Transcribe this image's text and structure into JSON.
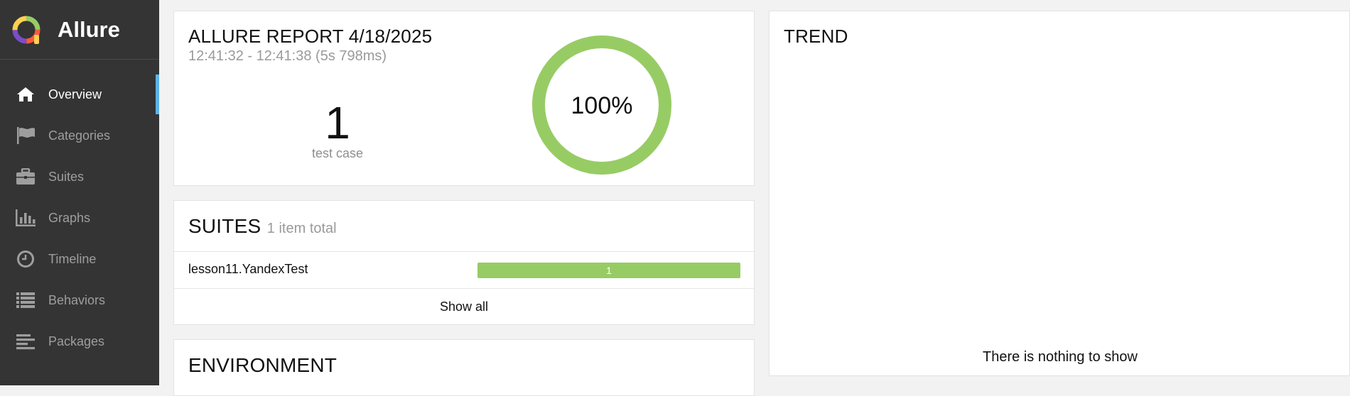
{
  "brand": {
    "name": "Allure"
  },
  "sidebar": {
    "items": [
      {
        "label": "Overview",
        "icon": "home-icon",
        "active": true
      },
      {
        "label": "Categories",
        "icon": "flag-icon"
      },
      {
        "label": "Suites",
        "icon": "briefcase-icon"
      },
      {
        "label": "Graphs",
        "icon": "bar-chart-icon"
      },
      {
        "label": "Timeline",
        "icon": "clock-icon"
      },
      {
        "label": "Behaviors",
        "icon": "list-icon"
      },
      {
        "label": "Packages",
        "icon": "align-left-icon"
      }
    ]
  },
  "summary": {
    "title": "ALLURE REPORT 4/18/2025",
    "time_range": "12:41:32 - 12:41:38 (5s 798ms)",
    "test_count": "1",
    "test_count_label": "test case",
    "pass_percent_label": "100%",
    "pass_fraction": 1.0
  },
  "suites": {
    "title": "SUITES",
    "subtitle": "1 item total",
    "rows": [
      {
        "name": "lesson11.YandexTest",
        "passed": "1"
      }
    ],
    "show_all": "Show all"
  },
  "environment": {
    "title": "ENVIRONMENT"
  },
  "trend": {
    "title": "TREND",
    "empty_text": "There is nothing to show"
  },
  "colors": {
    "sidebar_bg": "#343434",
    "active_accent": "#5cb3e8",
    "passed": "#97cc64",
    "page_bg": "#f2f2f2"
  }
}
